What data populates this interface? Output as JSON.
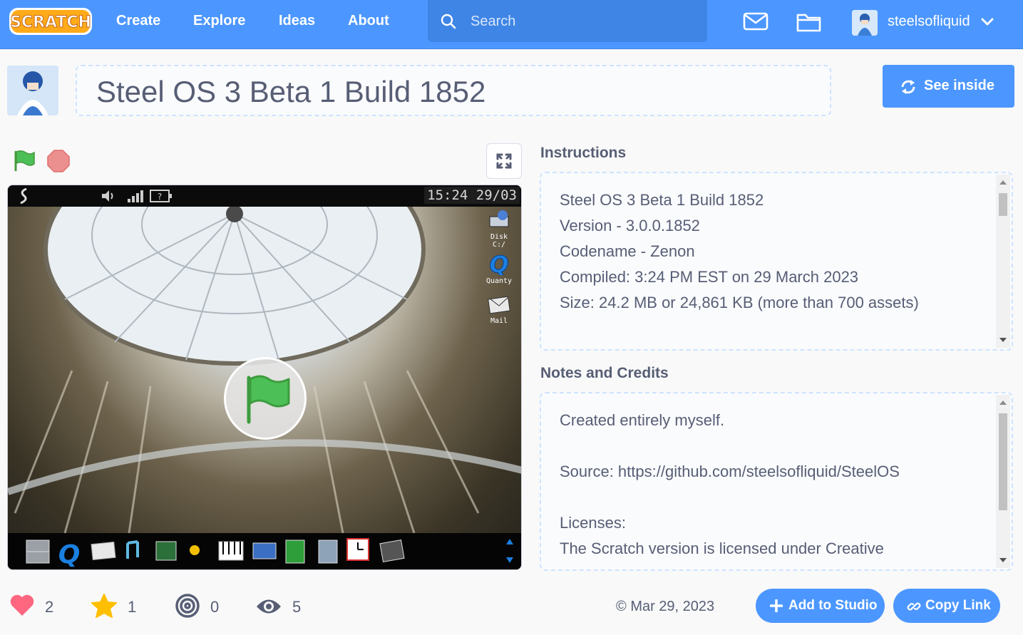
{
  "nav": {
    "logo_text": "SCRATCH",
    "links": [
      "Create",
      "Explore",
      "Ideas",
      "About"
    ],
    "search_placeholder": "Search",
    "username": "steelsofliquid"
  },
  "project": {
    "title": "Steel OS 3 Beta 1 Build 1852",
    "see_inside_label": "See inside"
  },
  "stage": {
    "os_clock": "15:24 29/03",
    "desktop_icons": [
      "Disk C:/",
      "Quanty",
      "Mail"
    ]
  },
  "instructions": {
    "heading": "Instructions",
    "lines": [
      "Steel OS 3 Beta 1 Build 1852",
      "Version - 3.0.0.1852",
      "Codename - Zenon",
      "Compiled: 3:24 PM EST on 29 March 2023",
      "Size: 24.2 MB or 24,861 KB (more than 700 assets)"
    ]
  },
  "notes": {
    "heading": "Notes and Credits",
    "lines": [
      "Created entirely myself.",
      "",
      "Source: https://github.com/steelsofliquid/SteelOS",
      "",
      "Licenses:",
      "The Scratch version is licensed under Creative"
    ]
  },
  "stats": {
    "loves": "2",
    "favorites": "1",
    "remixes": "0",
    "views": "5",
    "date": "Mar 29, 2023"
  },
  "actions": {
    "add_to_studio": "Add to Studio",
    "copy_link": "Copy Link"
  },
  "colors": {
    "brand_blue": "#4c97ff",
    "love_red": "#ff6680",
    "favorite_yellow": "#ffbf00",
    "flag_green": "#4cbf56",
    "stop_red": "#ec5959"
  }
}
